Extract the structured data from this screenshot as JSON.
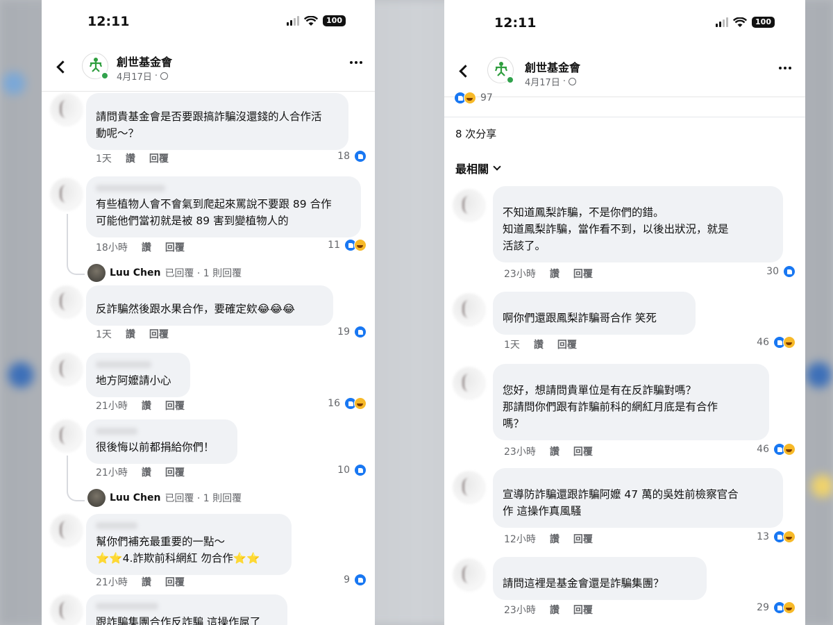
{
  "left": {
    "status": {
      "time": "12:11",
      "battery": "100"
    },
    "header": {
      "page_name": "創世基金會",
      "date": "4月17日",
      "date_sep": "·"
    },
    "comments": [
      {
        "text_lines": [
          "請問貴基金會是否要跟搞詐騙沒還錢的人合作活",
          "動呢～？"
        ],
        "time": "1天",
        "like": "讚",
        "reply": "回覆",
        "count": "18",
        "reactions": [
          "like"
        ]
      },
      {
        "text_lines": [
          "有些植物人會不會氣到爬起來罵說不要跟 89 合作",
          "可能他們當初就是被 89 害到變植物人的"
        ],
        "time": "18小時",
        "like": "讚",
        "reply": "回覆",
        "count": "11",
        "reactions": [
          "like",
          "haha"
        ],
        "reply_name": "Luu Chen",
        "reply_rest": "已回覆 · 1 則回覆"
      },
      {
        "text_lines": [
          "反詐騙然後跟水果合作，要確定欸😂😂😂"
        ],
        "time": "1天",
        "like": "讚",
        "reply": "回覆",
        "count": "19",
        "reactions": [
          "like"
        ]
      },
      {
        "text_lines": [
          "地方阿嬤請小心"
        ],
        "time": "21小時",
        "like": "讚",
        "reply": "回覆",
        "count": "16",
        "reactions": [
          "like",
          "haha"
        ]
      },
      {
        "text_lines": [
          "很後悔以前都捐給你們！"
        ],
        "time": "21小時",
        "like": "讚",
        "reply": "回覆",
        "count": "10",
        "reactions": [
          "like"
        ],
        "reply_name": "Luu Chen",
        "reply_rest": "已回覆 · 1 則回覆"
      },
      {
        "text_lines": [
          "幫你們補充最重要的一點～",
          "⭐⭐4.詐欺前科網紅 勿合作⭐⭐"
        ],
        "time": "21小時",
        "like": "讚",
        "reply": "回覆",
        "count": "9",
        "reactions": [
          "like"
        ]
      },
      {
        "text_lines": [
          "跟詐騙集團合作反詐騙 這操作屌了"
        ],
        "time": "",
        "like": "",
        "reply": "",
        "count": "",
        "reactions": []
      }
    ]
  },
  "right": {
    "status": {
      "time": "12:11",
      "battery": "100"
    },
    "header": {
      "page_name": "創世基金會",
      "date": "4月17日",
      "date_sep": "·"
    },
    "top_reaction_count": "97",
    "shares": "8 次分享",
    "sort": "最相關",
    "comments": [
      {
        "text_lines": [
          "不知道鳳梨詐騙，不是你們的錯。",
          "知道鳳梨詐騙，當作看不到，以後出狀況，就是",
          "活該了。"
        ],
        "time": "23小時",
        "like": "讚",
        "reply": "回覆",
        "count": "30",
        "reactions": [
          "like"
        ]
      },
      {
        "text_lines": [
          "啊你們還跟鳳梨詐騙哥合作 笑死"
        ],
        "time": "1天",
        "like": "讚",
        "reply": "回覆",
        "count": "46",
        "reactions": [
          "like",
          "haha"
        ]
      },
      {
        "text_lines": [
          "您好，想請問貴單位是有在反詐騙對嗎？",
          "那請問你們跟有詐騙前科的網紅月底是有合作",
          "嗎？"
        ],
        "time": "23小時",
        "like": "讚",
        "reply": "回覆",
        "count": "46",
        "reactions": [
          "like",
          "haha"
        ]
      },
      {
        "text_lines": [
          "宣導防詐騙還跟詐騙阿嬤 47 萬的吳姓前檢察官合",
          "作 這操作真風騷"
        ],
        "time": "12小時",
        "like": "讚",
        "reply": "回覆",
        "count": "13",
        "reactions": [
          "like",
          "haha"
        ]
      },
      {
        "text_lines": [
          "請問這裡是基金會還是詐騙集團？"
        ],
        "time": "23小時",
        "like": "讚",
        "reply": "回覆",
        "count": "29",
        "reactions": [
          "like",
          "haha"
        ]
      }
    ]
  }
}
